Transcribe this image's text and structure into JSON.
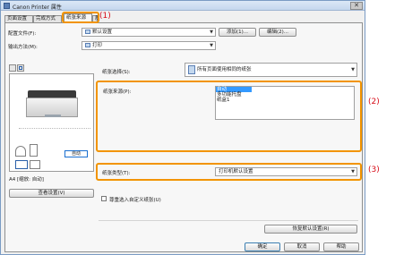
{
  "window": {
    "title": "Canon Printer 属性",
    "close_symbol": "✕"
  },
  "tabs": [
    {
      "label": "页面设置"
    },
    {
      "label": "完成方式"
    },
    {
      "label": "纸张来源"
    },
    {
      "label": "质"
    }
  ],
  "profile": {
    "label": "配置文件(F):",
    "value": "默认设置",
    "add_button": "添加(1)...",
    "edit_button": "编辑(2)..."
  },
  "output": {
    "label": "输出方法(M):",
    "value": "打印"
  },
  "paper_select": {
    "label": "纸张选择(S):",
    "value": "所有页面使用相同的纸张"
  },
  "paper_source": {
    "label": "纸张来源(P):",
    "items": [
      "自动",
      "多功能托盘",
      "纸盒1"
    ],
    "selected_index": 0
  },
  "paper_type": {
    "label": "纸张类型(T):",
    "value": "打印机默认设置"
  },
  "preview": {
    "auto_label": "自动",
    "status_text": "A4 [缩放: 自动]",
    "view_settings_button": "查看设置(V)"
  },
  "checkbox": {
    "label": "尊重选入自定义纸张(U)",
    "checked": false
  },
  "restore_button": "恢复默认设置(R)",
  "footer": {
    "ok": "确定",
    "cancel": "取消",
    "help": "帮助"
  },
  "callouts": [
    "(1)",
    "(2)",
    "(3)"
  ],
  "colors": {
    "highlight": "#f29400",
    "callout_text": "#d70c18",
    "selection": "#3399ff"
  }
}
